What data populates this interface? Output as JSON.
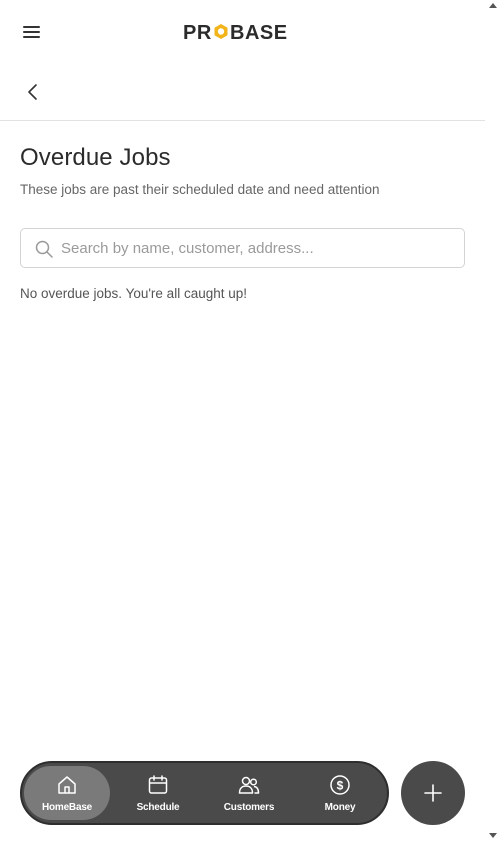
{
  "header": {
    "logo_text": "PROBASE",
    "menu_icon": "hamburger-menu-icon",
    "back_icon": "chevron-left-icon"
  },
  "page": {
    "title": "Overdue Jobs",
    "subtitle": "These jobs are past their scheduled date and need attention"
  },
  "search": {
    "placeholder": "Search by name, customer, address...",
    "value": "",
    "icon": "search-icon"
  },
  "empty_state": "No overdue jobs. You're all caught up!",
  "bottom_nav": {
    "items": [
      {
        "label": "HomeBase",
        "icon": "home-icon",
        "active": true
      },
      {
        "label": "Schedule",
        "icon": "calendar-icon",
        "active": false
      },
      {
        "label": "Customers",
        "icon": "users-icon",
        "active": false
      },
      {
        "label": "Money",
        "icon": "dollar-icon",
        "active": false
      }
    ],
    "fab_icon": "plus-icon"
  },
  "colors": {
    "nav_bg": "#4a4a4a",
    "nav_active": "#7a7a7a",
    "logo_accent": "#f2b418",
    "text_dark": "#2b2b2b"
  }
}
